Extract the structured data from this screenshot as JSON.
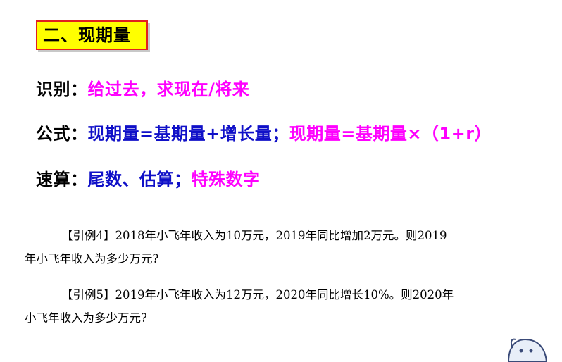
{
  "section": {
    "title": "二、现期量"
  },
  "lines": {
    "identify": {
      "label": "识别：",
      "content": "给过去，求现在/将来"
    },
    "formula": {
      "label": "公式：",
      "blue_part": "现期量=基期量+增长量；",
      "magenta_part": "现期量=基期量×（1+r）"
    },
    "quick": {
      "label": "速算：",
      "blue_part": "尾数、估算；",
      "magenta_part": "特殊数字"
    }
  },
  "examples": [
    {
      "line1": "【引例4】2018年小飞年收入为10万元，2019年同比增加2万元。则2019",
      "line2": "年小飞年收入为多少万元?"
    },
    {
      "line1": "【引例5】2019年小飞年收入为12万元，2020年同比增长10%。则2020年",
      "line2": "小飞年收入为多少万元?"
    }
  ],
  "colors": {
    "title_bg": "#ffff00",
    "title_border": "#e02020",
    "blue": "#1010c8",
    "magenta": "#ff00ff"
  },
  "icons": {
    "corner_decoration": "cartoon-character-icon"
  }
}
